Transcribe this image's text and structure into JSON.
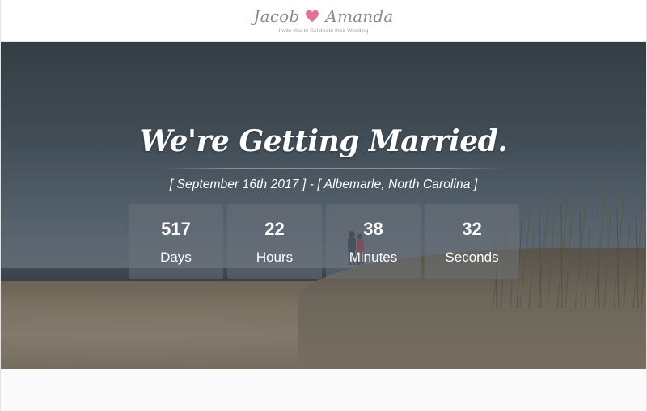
{
  "header": {
    "groom": "Jacob",
    "bride": "Amanda",
    "tagline": "Invite You to Celebrate their Wedding"
  },
  "hero": {
    "title": "We're Getting Married.",
    "subtitle": "[ September 16th 2017 ] - [ Albemarle, North Carolina ]"
  },
  "countdown": [
    {
      "value": "517",
      "label": "Days"
    },
    {
      "value": "22",
      "label": "Hours"
    },
    {
      "value": "38",
      "label": "Minutes"
    },
    {
      "value": "32",
      "label": "Seconds"
    }
  ],
  "colors": {
    "heart": "#e0729b",
    "brand_text": "#8b8b8b",
    "countdown_box": "rgba(110,118,126,0.45)"
  },
  "icons": {
    "heart": "heart-icon"
  }
}
